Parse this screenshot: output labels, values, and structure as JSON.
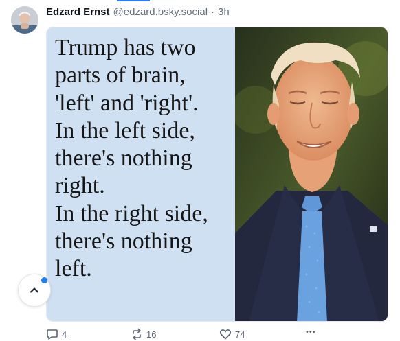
{
  "post": {
    "author_name": "Edzard Ernst",
    "handle": "@edzard.bsky.social",
    "separator": "·",
    "timestamp": "3h",
    "image_text_lines": [
      "Trump has two",
      "parts of brain,",
      "'left' and 'right'.",
      "In the left side,",
      "there's nothing",
      "right.",
      "In the right side,",
      "there's nothing",
      "left."
    ],
    "reply_count": "4",
    "repost_count": "16",
    "like_count": "74",
    "more_label": "•••"
  },
  "icons": {
    "reply": "speech-bubble-icon",
    "repost": "repost-arrows-icon",
    "like": "heart-icon",
    "more": "ellipsis-icon",
    "scroll_top": "chevron-up-icon"
  },
  "colors": {
    "accent": "#2f7bf0",
    "quote_background": "#cfe0f3",
    "muted_text": "#66707c",
    "notification_dot": "#1d7cf2"
  }
}
